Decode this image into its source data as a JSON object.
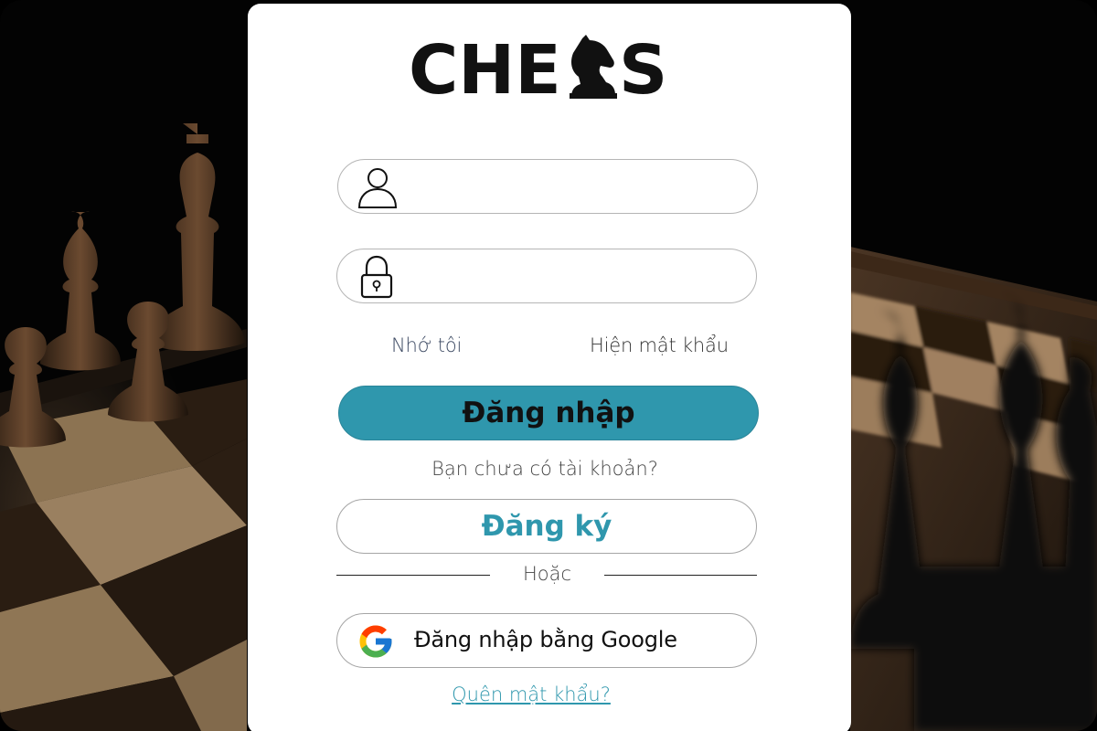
{
  "app": {
    "logo_text": "CHESS"
  },
  "form": {
    "username": {
      "value": "",
      "placeholder": ""
    },
    "password": {
      "value": "",
      "placeholder": ""
    },
    "remember_label": "Nhớ tôi",
    "show_password_label": "Hiện mật khẩu",
    "login_button": "Đăng nhập",
    "no_account_text": "Bạn chưa có tài khoản?",
    "register_button": "Đăng ký",
    "divider_text": "Hoặc",
    "google_button": "Đăng nhập bằng Google",
    "forgot_link": "Quên mật khẩu?"
  },
  "colors": {
    "accent": "#2f97ad",
    "card": "#ffffff",
    "text": "#111111"
  },
  "icons": {
    "username": "user-icon",
    "password": "lock-icon",
    "google": "google-icon",
    "logo_knight": "chess-knight-icon"
  }
}
